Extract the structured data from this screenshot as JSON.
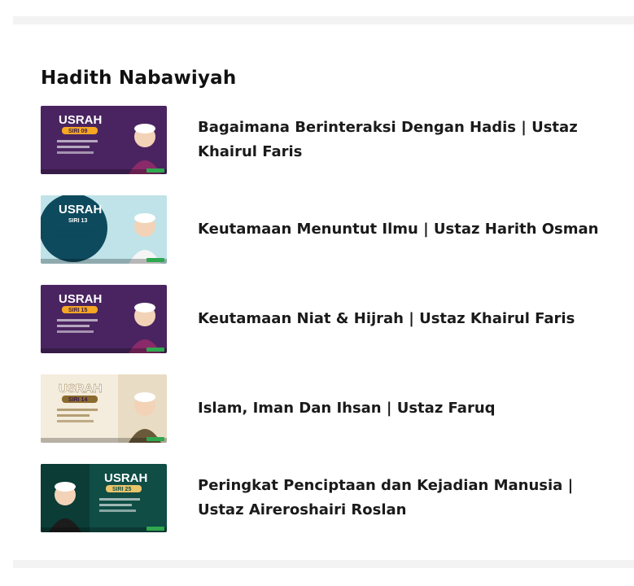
{
  "section": {
    "heading": "Hadith Nabawiyah"
  },
  "items": [
    {
      "title": "Bagaimana Berinteraksi Dengan Hadis | Ustaz Khairul Faris",
      "thumb": {
        "usrah": "USRAH",
        "siri": "SIRI 09",
        "theme": "purple",
        "bg": "#4a2460",
        "accent": "#f5a623"
      }
    },
    {
      "title": "Keutamaan Menuntut Ilmu | Ustaz Harith Osman",
      "thumb": {
        "usrah": "USRAH",
        "siri": "SIRI 13",
        "theme": "teal",
        "bg": "#bfe3e8",
        "accent": "#0e4a5e"
      }
    },
    {
      "title": "Keutamaan Niat & Hijrah | Ustaz Khairul Faris",
      "thumb": {
        "usrah": "USRAH",
        "siri": "SIRI 15",
        "theme": "purple",
        "bg": "#4a2460",
        "accent": "#f5a623"
      }
    },
    {
      "title": "Islam, Iman Dan Ihsan | Ustaz Faruq",
      "thumb": {
        "usrah": "USRAH",
        "siri": "SIRI 14",
        "theme": "beige",
        "bg": "#e9dcc4",
        "accent": "#8a6a2e"
      }
    },
    {
      "title": "Peringkat Penciptaan dan Kejadian Manusia | Ustaz Aireroshairi Roslan",
      "thumb": {
        "usrah": "USRAH",
        "siri": "SIRI 25",
        "theme": "green",
        "bg": "#0f4d45",
        "accent": "#e9c46a"
      }
    }
  ]
}
